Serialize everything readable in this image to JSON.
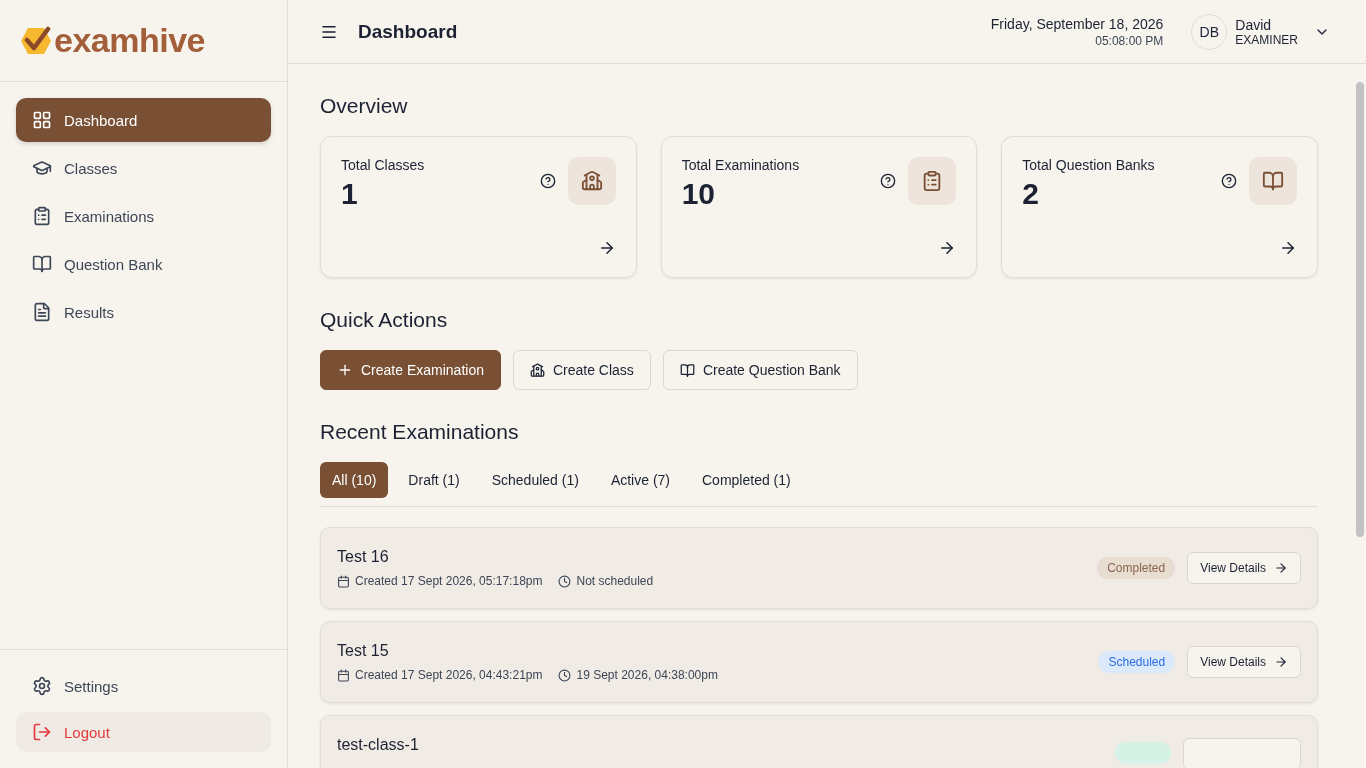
{
  "brand": {
    "name": "examhive"
  },
  "sidebar": {
    "items": [
      {
        "label": "Dashboard",
        "selected": true
      },
      {
        "label": "Classes",
        "selected": false
      },
      {
        "label": "Examinations",
        "selected": false
      },
      {
        "label": "Question Bank",
        "selected": false
      },
      {
        "label": "Results",
        "selected": false
      }
    ],
    "footer": [
      {
        "label": "Settings",
        "kind": "settings"
      },
      {
        "label": "Logout",
        "kind": "logout"
      }
    ]
  },
  "header": {
    "title": "Dashboard",
    "date": "Friday, September 18, 2026",
    "time": "05:08:00 PM",
    "user": {
      "initials": "DB",
      "name": "David",
      "role": "EXAMINER"
    }
  },
  "overview": {
    "title": "Overview",
    "cards": [
      {
        "label": "Total Classes",
        "value": "1"
      },
      {
        "label": "Total Examinations",
        "value": "10"
      },
      {
        "label": "Total Question Banks",
        "value": "2"
      }
    ]
  },
  "quick_actions": {
    "title": "Quick Actions",
    "buttons": [
      {
        "label": "Create Examination",
        "kind": "primary"
      },
      {
        "label": "Create Class",
        "kind": "outline"
      },
      {
        "label": "Create Question Bank",
        "kind": "outline"
      }
    ]
  },
  "recent": {
    "title": "Recent Examinations",
    "tabs": [
      {
        "label": "All (10)",
        "selected": true
      },
      {
        "label": "Draft (1)",
        "selected": false
      },
      {
        "label": "Scheduled (1)",
        "selected": false
      },
      {
        "label": "Active (7)",
        "selected": false
      },
      {
        "label": "Completed (1)",
        "selected": false
      }
    ],
    "rows": [
      {
        "title": "Test 16",
        "created": "Created 17 Sept 2026, 05:17:18pm",
        "schedule": "Not scheduled",
        "status": "Completed",
        "kind": "completed",
        "action": "View Details"
      },
      {
        "title": "Test 15",
        "created": "Created 17 Sept 2026, 04:43:21pm",
        "schedule": "19 Sept 2026, 04:38:00pm",
        "status": "Scheduled",
        "kind": "scheduled",
        "action": "View Details"
      },
      {
        "title": "test-class-1",
        "kind": "active"
      }
    ]
  }
}
